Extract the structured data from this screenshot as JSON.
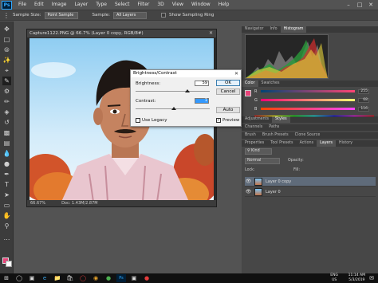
{
  "menubar": {
    "logo": "Ps",
    "items": [
      "File",
      "Edit",
      "Image",
      "Layer",
      "Type",
      "Select",
      "Filter",
      "3D",
      "View",
      "Window",
      "Help"
    ]
  },
  "options": {
    "sample_size_label": "Sample Size:",
    "sample_size_value": "Point Sample",
    "sample_label": "Sample:",
    "sample_value": "All Layers",
    "show_ring_label": "Show Sampling Ring"
  },
  "document": {
    "tab_title": "Capture1122.PNG @ 66.7% (Layer 0 copy, RGB/8#)",
    "zoom": "66.67%",
    "doc_size": "Doc: 1.43M/2.87M"
  },
  "panels": {
    "top_tabs": [
      "Navigator",
      "Info",
      "Histogram"
    ],
    "color_tabs": [
      "Color",
      "Swatches"
    ],
    "color_sliders": [
      {
        "letter": "R",
        "value": "255"
      },
      {
        "letter": "G",
        "value": "68"
      },
      {
        "letter": "B",
        "value": "116"
      }
    ],
    "adj_tabs": [
      "Adjustments",
      "Styles"
    ],
    "paths_tabs": [
      "Channels",
      "Paths"
    ],
    "misc_tabs": [
      "Brush",
      "Brush Presets",
      "Clone Source"
    ],
    "layer_tabs": [
      "Properties",
      "Tool Presets",
      "Actions",
      "Layers",
      "History"
    ],
    "kind_label": "Kind",
    "blend_mode": "Normal",
    "opacity_label": "Opacity:",
    "lock_label": "Lock:",
    "fill_label": "Fill:",
    "layers": [
      {
        "name": "Layer 0 copy"
      },
      {
        "name": "Layer 0"
      }
    ]
  },
  "dialog": {
    "title": "Brightness/Contrast",
    "brightness_label": "Brightness:",
    "brightness_value": "59",
    "contrast_label": "Contrast:",
    "contrast_value": "1",
    "ok": "OK",
    "cancel": "Cancel",
    "auto": "Auto",
    "preview_label": "Preview",
    "legacy_label": "Use Legacy"
  },
  "taskbar": {
    "lang_top": "ENG",
    "lang_bottom": "US",
    "time": "11:14 AM",
    "date": "5/3/2019"
  }
}
